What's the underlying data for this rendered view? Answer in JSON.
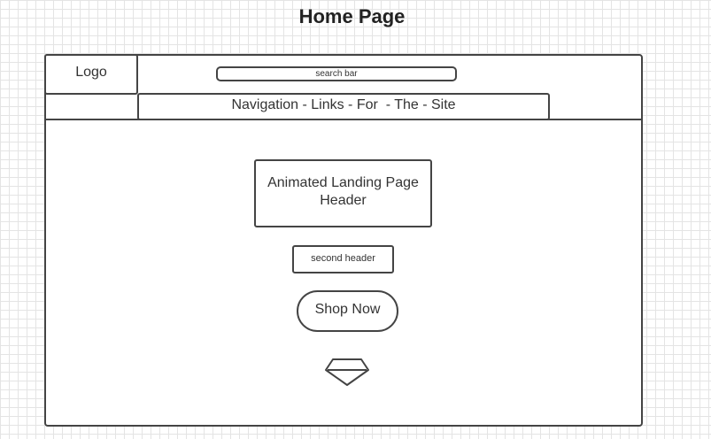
{
  "page": {
    "title": "Home Page"
  },
  "header": {
    "logo_label": "Logo",
    "search_placeholder": "search bar",
    "navigation_label": "Navigation - Links - For  - The - Site"
  },
  "hero": {
    "headline": "Animated Landing Page Header",
    "subheadline": "second header",
    "cta_label": "Shop Now",
    "scroll_icon": "chevron-down-icon"
  },
  "colors": {
    "stroke": "#444444",
    "grid": "#e4e4e4",
    "text": "#333333"
  }
}
